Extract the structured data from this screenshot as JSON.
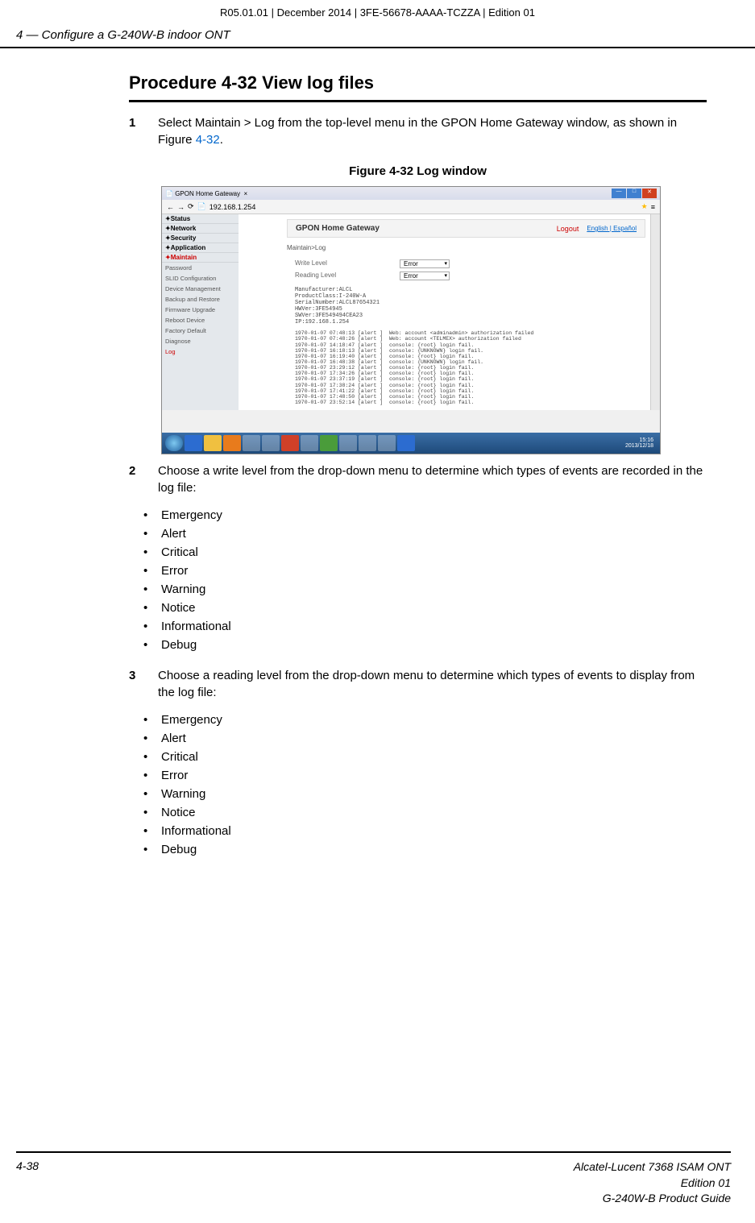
{
  "top_header": "R05.01.01 | December 2014 | 3FE-56678-AAAA-TCZZA | Edition 01",
  "page_header": "4 —  Configure a G-240W-B indoor ONT",
  "procedure_title": "Procedure 4-32  View log files",
  "steps": {
    "s1_num": "1",
    "s1_text_a": "Select Maintain > Log from the top-level menu in the GPON Home Gateway window, as shown in Figure ",
    "s1_link": "4-32",
    "s1_text_b": ".",
    "s2_num": "2",
    "s2_text": "Choose a write level from the drop-down menu to determine which types of events are recorded in the log file:",
    "s3_num": "3",
    "s3_text": "Choose a reading level from the drop-down menu to determine which types of events to display from the log file:"
  },
  "figure_caption": "Figure 4-32  Log window",
  "screenshot": {
    "tab_title": "GPON Home Gateway",
    "url": "192.168.1.254",
    "brand": "GPON Home Gateway",
    "logout": "Logout",
    "lang": "English | Español",
    "breadcrumb": "Maintain>Log",
    "sidebar_primary": [
      "Status",
      "Network",
      "Security",
      "Application",
      "Maintain"
    ],
    "sidebar_sub": [
      "Password",
      "SLID Configuration",
      "Device Management",
      "Backup and Restore",
      "Firmware Upgrade",
      "Reboot Device",
      "Factory Default",
      "Diagnose",
      "Log"
    ],
    "write_label": "Write Level",
    "write_val": "Error",
    "read_label": "Reading Level",
    "read_val": "Error",
    "info": "Manufacturer:ALCL\nProductClass:I-240W-A\nSerialNumber:ALCL87654321\nHWVer:3FE54945\nSWVer:3FE549494CEA23\nIP:192.168.1.254",
    "log": "1970-01-07 07:48:13 [alert ]  Web: account <adminadmin> authorization failed\n1970-01-07 07:48:26 [alert ]  Web: account <TELMEX> authorization failed\n1970-01-07 14:18:47 [alert ]  console: {root} login fail.\n1970-01-07 16:18:13 [alert ]  console: {UNKNOWN} login fail.\n1970-01-07 16:19:40 [alert ]  console: {root} login fail.\n1970-01-07 16:48:38 [alert ]  console: {UNKNOWN} login fail.\n1970-01-07 23:29:12 [alert ]  console: {root} login fail.\n1970-01-07 17:34:26 [alert ]  console: {root} login fail.\n1970-01-07 23:37:19 [alert ]  console: {root} login fail.\n1970-01-07 17:38:24 [alert ]  console: {root} login fail.\n1970-01-07 17:41:22 [alert ]  console: {root} login fail.\n1970-01-07 17:48:50 [alert ]  console: {root} login fail.\n1970-01-07 23:52:14 [alert ]  console: {root} login fail.",
    "clock_time": "15:16",
    "clock_date": "2013/12/18"
  },
  "levels": [
    "Emergency",
    "Alert",
    "Critical",
    "Error",
    "Warning",
    "Notice",
    "Informational",
    "Debug"
  ],
  "footer": {
    "page_num": "4-38",
    "line1": "Alcatel-Lucent 7368 ISAM ONT",
    "line2": "Edition 01",
    "line3": "G-240W-B Product Guide"
  }
}
